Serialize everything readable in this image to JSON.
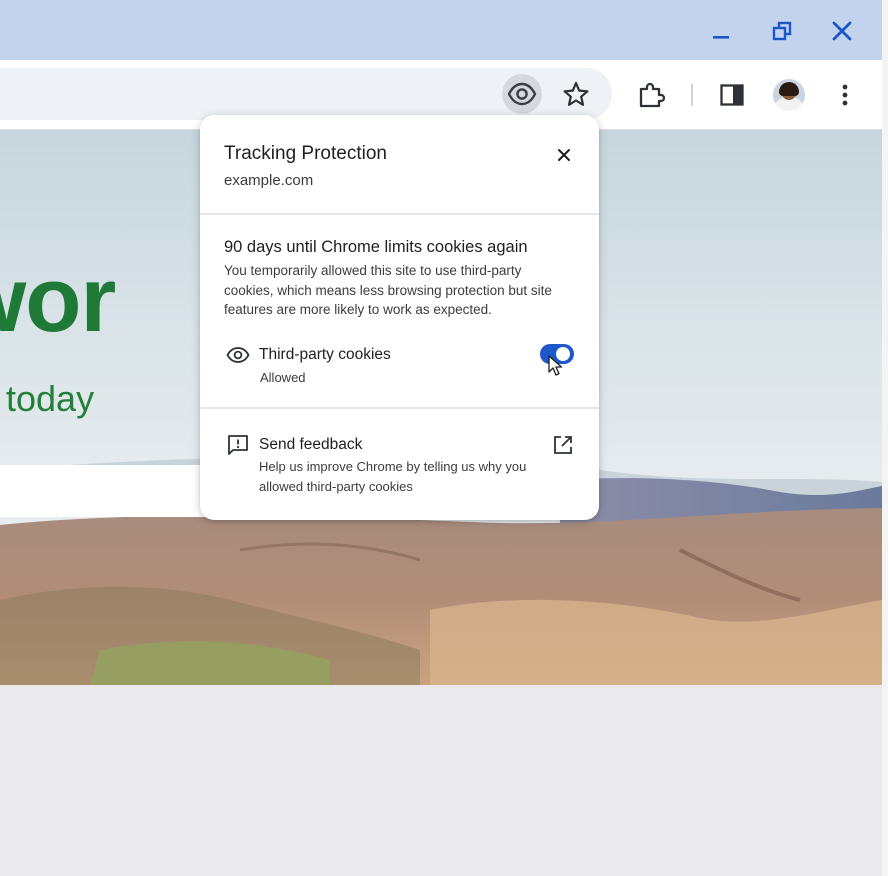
{
  "window": {
    "controls": [
      {
        "icon": "minimize-icon"
      },
      {
        "icon": "restore-icon"
      },
      {
        "icon": "close-icon"
      }
    ]
  },
  "toolbar": {
    "omnibox_icons": [
      "eye-icon",
      "star-icon"
    ],
    "buttons": [
      "extensions-icon",
      "side-panel-icon",
      "profile-avatar",
      "more-vert-icon"
    ]
  },
  "page": {
    "hero_title": "e wor",
    "hero_subtitle": "today"
  },
  "popup": {
    "title": "Tracking Protection",
    "site": "example.com",
    "heading": "90 days until Chrome limits cookies again",
    "description": "You temporarily allowed this site to use third-party cookies, which means less browsing protection but site features are more likely to work as expected.",
    "cookies_row": {
      "label": "Third-party cookies",
      "status": "Allowed",
      "toggle_on": true
    },
    "feedback_row": {
      "label": "Send feedback",
      "description": "Help us improve Chrome by telling us why you allowed third-party cookies"
    }
  },
  "colors": {
    "titlebar": "#c3d3ee",
    "accent": "#1d57c9",
    "hero_text": "#1e7a36"
  }
}
